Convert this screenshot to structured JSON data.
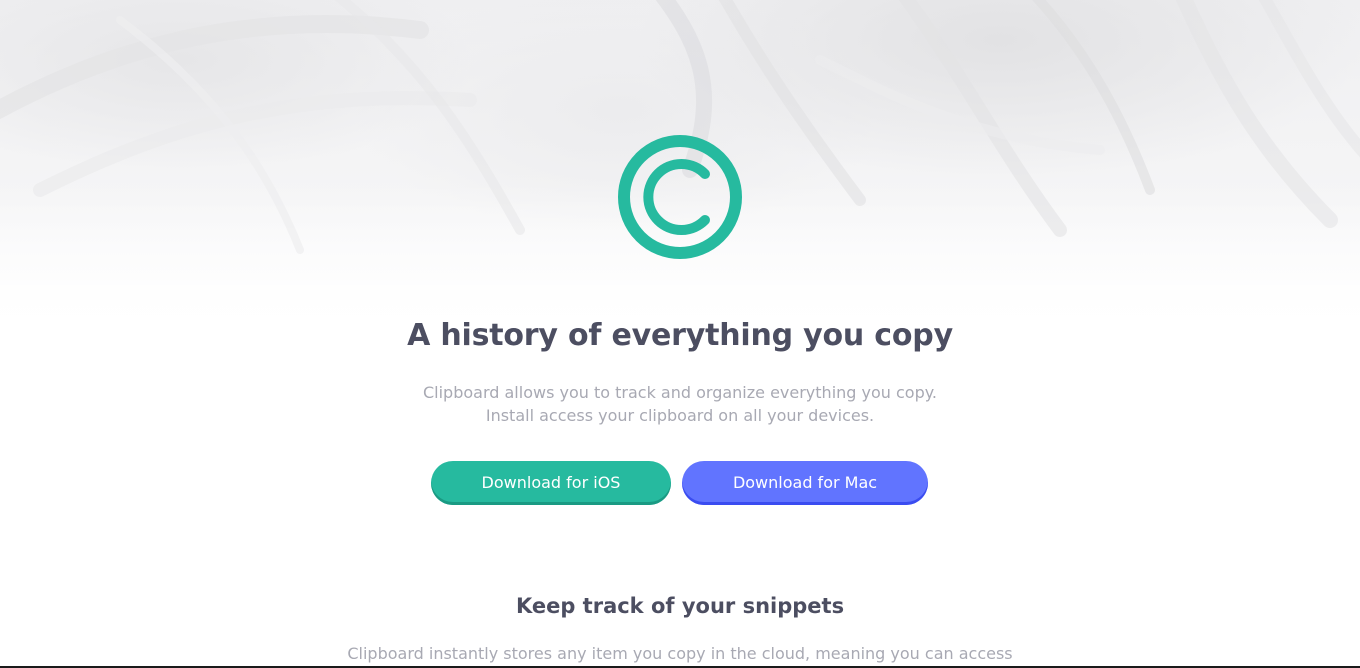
{
  "hero": {
    "headline": "A history of everything you copy",
    "subtitle_line1": "Clipboard allows you to track and organize everything you copy.",
    "subtitle_line2": "Install access your clipboard on all your devices.",
    "logo_icon": "copyright-icon",
    "accent_color": "#26ba9f"
  },
  "buttons": {
    "ios_label": "Download for iOS",
    "mac_label": "Download for Mac",
    "ios_color": "#26ba9f",
    "mac_color": "#6174ff"
  },
  "snippets": {
    "title": "Keep track of your snippets",
    "body": "Clipboard instantly stores any item you copy in the cloud, meaning you can access"
  }
}
